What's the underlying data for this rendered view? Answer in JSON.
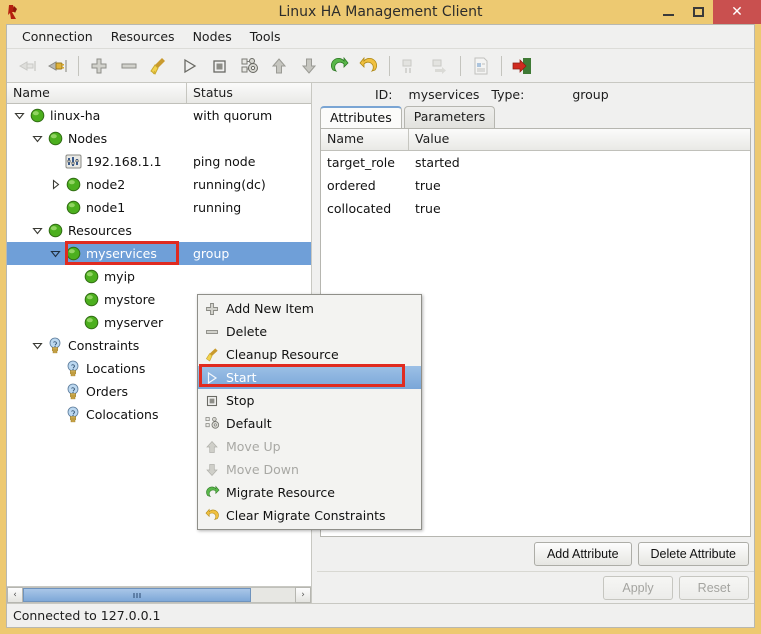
{
  "window": {
    "title": "Linux HA Management Client",
    "app_icon": "pacemaker-icon",
    "minimize_label": "–",
    "maximize_label": "□",
    "close_label": "✕"
  },
  "menubar": {
    "items": [
      {
        "label": "Connection",
        "name": "menu-connection"
      },
      {
        "label": "Resources",
        "name": "menu-resources"
      },
      {
        "label": "Nodes",
        "name": "menu-nodes"
      },
      {
        "label": "Tools",
        "name": "menu-tools"
      }
    ]
  },
  "toolbar": {
    "buttons": [
      {
        "name": "connect-icon",
        "title": "Connect",
        "enabled": false
      },
      {
        "name": "disconnect-icon",
        "title": "Disconnect",
        "enabled": true
      },
      {
        "name": "separator",
        "title": "",
        "enabled": true
      },
      {
        "name": "add-icon",
        "title": "Add",
        "enabled": true
      },
      {
        "name": "remove-icon",
        "title": "Remove",
        "enabled": true
      },
      {
        "name": "cleanup-broom-icon",
        "title": "Cleanup Resource",
        "enabled": true
      },
      {
        "name": "start-play-icon",
        "title": "Start",
        "enabled": true
      },
      {
        "name": "stop-square-icon",
        "title": "Stop",
        "enabled": true
      },
      {
        "name": "default-gears-icon",
        "title": "Default",
        "enabled": true
      },
      {
        "name": "move-up-icon",
        "title": "Move Up",
        "enabled": true
      },
      {
        "name": "move-down-icon",
        "title": "Move Down",
        "enabled": true
      },
      {
        "name": "migrate-resource-icon",
        "title": "Migrate Resource",
        "enabled": true
      },
      {
        "name": "clear-migrate-constraints-icon",
        "title": "Clear Migrate Constraints",
        "enabled": true
      },
      {
        "name": "separator",
        "title": "",
        "enabled": true
      },
      {
        "name": "standby-icon",
        "title": "Standby",
        "enabled": false
      },
      {
        "name": "activate-icon",
        "title": "Activate",
        "enabled": false
      },
      {
        "name": "separator",
        "title": "",
        "enabled": true
      },
      {
        "name": "document-icon",
        "title": "Report",
        "enabled": false
      },
      {
        "name": "separator",
        "title": "",
        "enabled": true
      },
      {
        "name": "quit-exit-icon",
        "title": "Quit",
        "enabled": true
      }
    ]
  },
  "tree": {
    "columns": {
      "name": "Name",
      "status": "Status"
    },
    "rows": [
      {
        "label": "linux-ha",
        "status": "with quorum",
        "indent": 0,
        "twisty": "expanded",
        "icon": "green-ball-icon",
        "selected": false,
        "highlighted": false
      },
      {
        "label": "Nodes",
        "status": "",
        "indent": 1,
        "twisty": "expanded",
        "icon": "green-ball-icon",
        "selected": false,
        "highlighted": false
      },
      {
        "label": "192.168.1.1",
        "status": "ping node",
        "indent": 2,
        "twisty": "none",
        "icon": "ping-node-icon",
        "selected": false,
        "highlighted": false
      },
      {
        "label": "node2",
        "status": "running(dc)",
        "indent": 2,
        "twisty": "collapsed",
        "icon": "green-ball-icon",
        "selected": false,
        "highlighted": false
      },
      {
        "label": "node1",
        "status": "running",
        "indent": 2,
        "twisty": "none",
        "icon": "green-ball-icon",
        "selected": false,
        "highlighted": false
      },
      {
        "label": "Resources",
        "status": "",
        "indent": 1,
        "twisty": "expanded",
        "icon": "green-ball-icon",
        "selected": false,
        "highlighted": false
      },
      {
        "label": "myservices",
        "status": "group",
        "indent": 2,
        "twisty": "expanded",
        "icon": "green-ball-icon",
        "selected": true,
        "highlighted": true
      },
      {
        "label": "myip",
        "status": "",
        "indent": 3,
        "twisty": "none",
        "icon": "green-ball-icon",
        "selected": false,
        "highlighted": false
      },
      {
        "label": "mystore",
        "status": "",
        "indent": 3,
        "twisty": "none",
        "icon": "green-ball-icon",
        "selected": false,
        "highlighted": false
      },
      {
        "label": "myserver",
        "status": "",
        "indent": 3,
        "twisty": "none",
        "icon": "green-ball-icon",
        "selected": false,
        "highlighted": false
      },
      {
        "label": "Constraints",
        "status": "",
        "indent": 1,
        "twisty": "expanded",
        "icon": "lightbulb-icon",
        "selected": false,
        "highlighted": false
      },
      {
        "label": "Locations",
        "status": "",
        "indent": 2,
        "twisty": "none",
        "icon": "lightbulb-icon",
        "selected": false,
        "highlighted": false
      },
      {
        "label": "Orders",
        "status": "",
        "indent": 2,
        "twisty": "none",
        "icon": "lightbulb-icon",
        "selected": false,
        "highlighted": false
      },
      {
        "label": "Colocations",
        "status": "",
        "indent": 2,
        "twisty": "none",
        "icon": "lightbulb-icon",
        "selected": false,
        "highlighted": false
      }
    ],
    "scrollbar": {
      "left_arrow": "‹",
      "right_arrow": "›",
      "thumb_grip": "‖‖"
    }
  },
  "context_menu": {
    "items": [
      {
        "label": "Add New Item",
        "icon": "plus-icon",
        "enabled": true,
        "highlighted": false
      },
      {
        "label": "Delete",
        "icon": "minus-icon",
        "enabled": true,
        "highlighted": false
      },
      {
        "label": "Cleanup Resource",
        "icon": "broom-icon",
        "enabled": true,
        "highlighted": false
      },
      {
        "label": "Start",
        "icon": "play-triangle-icon",
        "enabled": true,
        "highlighted": true
      },
      {
        "label": "Stop",
        "icon": "stop-square-icon",
        "enabled": true,
        "highlighted": false
      },
      {
        "label": "Default",
        "icon": "gears-icon",
        "enabled": true,
        "highlighted": false
      },
      {
        "label": "Move Up",
        "icon": "arrow-up-icon",
        "enabled": false,
        "highlighted": false
      },
      {
        "label": "Move Down",
        "icon": "arrow-down-icon",
        "enabled": false,
        "highlighted": false
      },
      {
        "label": "Migrate Resource",
        "icon": "migrate-green-arrow-icon",
        "enabled": true,
        "highlighted": false
      },
      {
        "label": "Clear Migrate Constraints",
        "icon": "undo-yellow-arrow-icon",
        "enabled": true,
        "highlighted": false
      }
    ]
  },
  "detail": {
    "id_label": "ID:",
    "id_value": "myservices",
    "type_label": "Type:",
    "type_value": "group",
    "tabs": [
      {
        "label": "Attributes",
        "active": true
      },
      {
        "label": "Parameters",
        "active": false
      }
    ],
    "table": {
      "columns": {
        "name": "Name",
        "value": "Value"
      },
      "rows": [
        {
          "name": "target_role",
          "value": "started"
        },
        {
          "name": "ordered",
          "value": "true"
        },
        {
          "name": "collocated",
          "value": "true"
        }
      ]
    },
    "buttons": {
      "add_attribute": "Add Attribute",
      "delete_attribute": "Delete Attribute",
      "apply": "Apply",
      "reset": "Reset"
    }
  },
  "statusbar": {
    "text": "Connected to 127.0.0.1"
  },
  "colors": {
    "window_frame": "#edc971",
    "titlebar": "#edc971",
    "close_button": "#c9504f",
    "selection": "#6f9fd8",
    "highlight_box": "#e02b20",
    "node_green": "#4caf1e",
    "panel_bg": "#f0f0ef"
  }
}
